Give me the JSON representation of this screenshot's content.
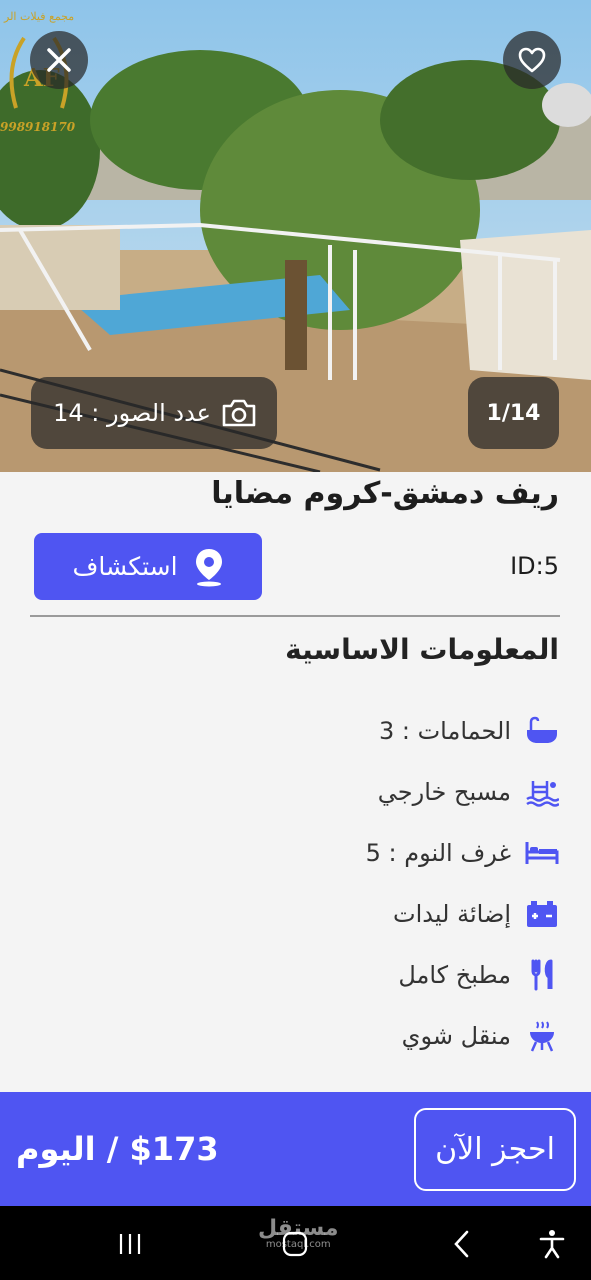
{
  "gallery": {
    "brand": "مجمع فيلات الر",
    "phone": "998918170",
    "photos_count_label": "عدد الصور : 14",
    "counter": "1/14"
  },
  "listing": {
    "title": "ريف دمشق-كروم مضايا",
    "explore_label": "استكشاف",
    "id_label": "ID:5"
  },
  "basic_info": {
    "heading": "المعلومات الاساسية",
    "items": [
      {
        "label": "الحمامات : 3",
        "icon": "bathtub-icon"
      },
      {
        "label": "مسبح خارجي",
        "icon": "pool-icon"
      },
      {
        "label": "غرف النوم : 5",
        "icon": "bed-icon"
      },
      {
        "label": "إضائة ليدات",
        "icon": "battery-icon"
      },
      {
        "label": "مطبخ كامل",
        "icon": "utensils-icon"
      },
      {
        "label": "منقل شوي",
        "icon": "grill-icon"
      }
    ]
  },
  "booking": {
    "price_label": "$173 / اليوم",
    "book_label": "احجز الآن"
  },
  "watermark": {
    "text": "مستقل",
    "sub": "mostaql.com"
  },
  "colors": {
    "accent": "#4f55f2",
    "overlay": "#282828"
  }
}
